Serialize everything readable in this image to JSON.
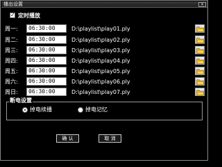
{
  "window": {
    "title": "播出设置",
    "close_glyph": "×"
  },
  "timed_play": {
    "label": "定时播放",
    "checked": true,
    "check_glyph": "✓"
  },
  "days": [
    {
      "label": "周一:",
      "time": "06:30:00",
      "path": "D:\\playlist\\play01.ply"
    },
    {
      "label": "周二:",
      "time": "06:30:00",
      "path": "D:\\playlist\\play02.ply"
    },
    {
      "label": "周三:",
      "time": "06:30:00",
      "path": "D:\\playlist\\play03.ply"
    },
    {
      "label": "周四:",
      "time": "06:30:00",
      "path": "D:\\playlist\\play04.ply"
    },
    {
      "label": "周五:",
      "time": "06:30:00",
      "path": "D:\\playlist\\play05.ply"
    },
    {
      "label": "周六:",
      "time": "06:30:00",
      "path": "D:\\playlist\\play06.ply"
    },
    {
      "label": "周日:",
      "time": "06:30:00",
      "path": "D:\\playlist\\play07.ply"
    }
  ],
  "browse_icon": "folder-icon",
  "power_outage": {
    "legend": "断电设置",
    "options": [
      {
        "label": "掉电续播",
        "selected": true
      },
      {
        "label": "掉电记忆",
        "selected": false
      }
    ]
  },
  "buttons": {
    "ok": "确 认",
    "cancel": "取 消"
  },
  "colors": {
    "background": "#000000",
    "text": "#ffffff",
    "folder": "#e0b020"
  }
}
